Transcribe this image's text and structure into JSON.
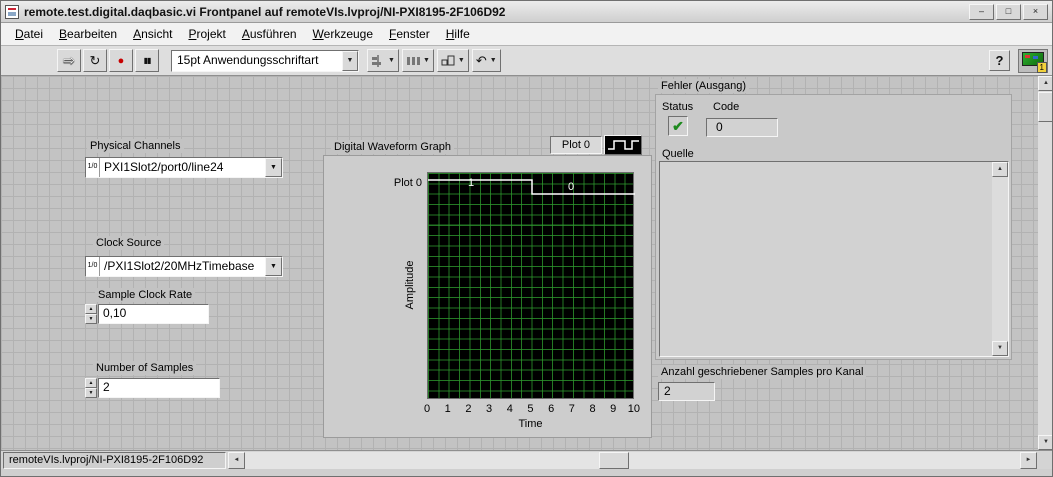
{
  "window": {
    "title": "remote.test.digital.daqbasic.vi Frontpanel auf remoteVIs.lvproj/NI-PXI8195-2F106D92"
  },
  "icons": {
    "minimize": "–",
    "maximize": "□",
    "close": "×",
    "run": "⇨",
    "run_continuous": "↻",
    "abort": "●",
    "pause": "▮▮",
    "dropdown": "▼",
    "undo": "↶",
    "help": "?",
    "check": "✔",
    "spin_up": "▲",
    "spin_down": "▼",
    "scroll_up": "▲",
    "scroll_down": "▼",
    "scroll_left": "◄",
    "scroll_right": "►",
    "io": "1/0"
  },
  "menu": {
    "items": [
      "Datei",
      "Bearbeiten",
      "Ansicht",
      "Projekt",
      "Ausführen",
      "Werkzeuge",
      "Fenster",
      "Hilfe"
    ]
  },
  "toolbar": {
    "font_selector": "15pt Anwendungsschriftart",
    "connection_badge": "1"
  },
  "panel": {
    "physical_channels": {
      "label": "Physical Channels",
      "value": "PXI1Slot2/port0/line24"
    },
    "clock_source": {
      "label": "Clock Source",
      "value": "/PXI1Slot2/20MHzTimebase"
    },
    "sample_clock_rate": {
      "label": "Sample Clock Rate",
      "value": "0,10"
    },
    "number_of_samples": {
      "label": "Number of Samples",
      "value": "2"
    }
  },
  "graph": {
    "label": "Digital Waveform Graph",
    "legend": {
      "plot_name": "Plot 0"
    },
    "plot_row_label": "Plot 0",
    "y_axis_label": "Amplitude",
    "x_axis_label": "Time",
    "x_ticks": [
      "0",
      "1",
      "2",
      "3",
      "4",
      "5",
      "6",
      "7",
      "8",
      "9",
      "10"
    ],
    "waveform": {
      "segment_labels": [
        "1",
        "0"
      ],
      "samples": [
        1,
        0
      ],
      "transition_x": 5,
      "x_range": [
        0,
        10
      ]
    }
  },
  "error_cluster": {
    "title": "Fehler (Ausgang)",
    "status": {
      "label": "Status"
    },
    "code": {
      "label": "Code",
      "value": "0"
    },
    "source": {
      "label": "Quelle",
      "value": ""
    }
  },
  "samples_written": {
    "label": "Anzahl geschriebener Samples pro Kanal",
    "value": "2"
  },
  "status_bar": {
    "tab_label": "remoteVIs.lvproj/NI-PXI8195-2F106D92"
  },
  "chart_data": {
    "type": "line",
    "title": "Digital Waveform Graph",
    "xlabel": "Time",
    "ylabel": "Amplitude",
    "xlim": [
      0,
      10
    ],
    "x_ticks": [
      0,
      1,
      2,
      3,
      4,
      5,
      6,
      7,
      8,
      9,
      10
    ],
    "grid": true,
    "legend_position": "top-right",
    "series": [
      {
        "name": "Plot 0",
        "kind": "digital",
        "points": [
          [
            0,
            1
          ],
          [
            5,
            1
          ],
          [
            5,
            0
          ],
          [
            10,
            0
          ]
        ],
        "segment_labels": [
          "1",
          "0"
        ]
      }
    ]
  }
}
